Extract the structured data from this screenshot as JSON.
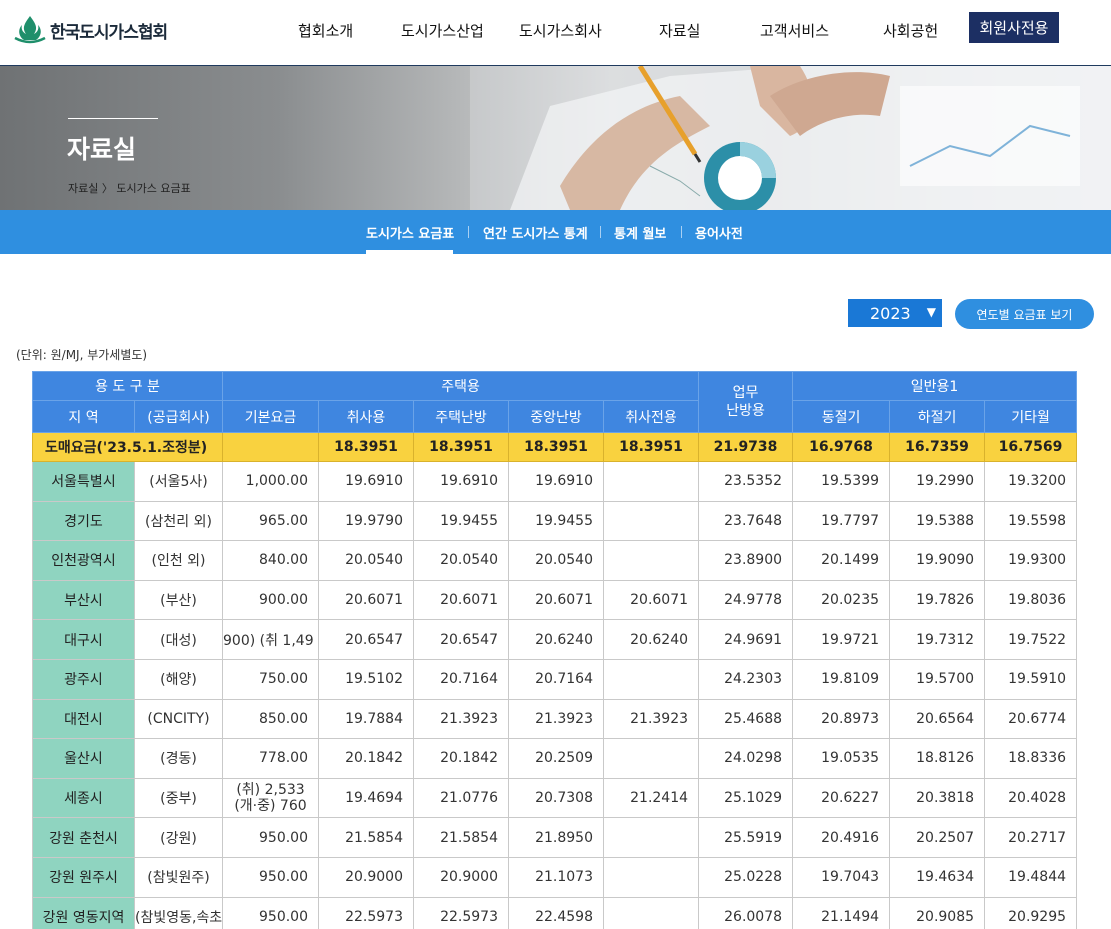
{
  "header": {
    "logo_text": "한국도시가스협회",
    "nav": [
      "협회소개",
      "도시가스산업",
      "도시가스회사",
      "자료실",
      "고객서비스",
      "사회공헌"
    ],
    "member_button": "회원사전용"
  },
  "banner": {
    "title": "자료실",
    "breadcrumb_root": "자료실",
    "breadcrumb_sep": "〉",
    "breadcrumb_current": "도시가스 요금표"
  },
  "subnav": {
    "items": [
      "도시가스 요금표",
      "연간 도시가스 통계",
      "통계 월보",
      "용어사전"
    ],
    "active": "도시가스 요금표"
  },
  "controls": {
    "year": "2023",
    "year_button": "연도별 요금표 보기"
  },
  "unit_note": "(단위: 원/MJ, 부가세별도)",
  "table": {
    "group_headers": {
      "usage_type": "용 도 구 분",
      "residential": "주택용",
      "business_heating": "업무\n난방용",
      "general1": "일반용1"
    },
    "sub_headers": [
      "지 역",
      "(공급회사)",
      "기본요금",
      "취사용",
      "주택난방",
      "중앙난방",
      "취사전용",
      "동절기",
      "하절기",
      "기타월"
    ],
    "wholesale": {
      "label": "도매요금('23.5.1.조정분)",
      "values": [
        "",
        "18.3951",
        "18.3951",
        "18.3951",
        "18.3951",
        "21.9738",
        "16.9768",
        "16.7359",
        "16.7569"
      ]
    },
    "rows": [
      {
        "region": "서울특별시",
        "company": "(서울5사)",
        "base": "1,000.00",
        "cooking": "19.6910",
        "home_heating": "19.6910",
        "central_heating": "19.6910",
        "cooking_only": "",
        "business": "23.5352",
        "winter": "19.5399",
        "summer": "19.2990",
        "other": "19.3200"
      },
      {
        "region": "경기도",
        "company": "(삼천리 외)",
        "base": "965.00",
        "cooking": "19.9790",
        "home_heating": "19.9455",
        "central_heating": "19.9455",
        "cooking_only": "",
        "business": "23.7648",
        "winter": "19.7797",
        "summer": "19.5388",
        "other": "19.5598"
      },
      {
        "region": "인천광역시",
        "company": "(인천 외)",
        "base": "840.00",
        "cooking": "20.0540",
        "home_heating": "20.0540",
        "central_heating": "20.0540",
        "cooking_only": "",
        "business": "23.8900",
        "winter": "20.1499",
        "summer": "19.9090",
        "other": "19.9300"
      },
      {
        "region": "부산시",
        "company": "(부산)",
        "base": "900.00",
        "cooking": "20.6071",
        "home_heating": "20.6071",
        "central_heating": "20.6071",
        "cooking_only": "20.6071",
        "business": "24.9778",
        "winter": "20.0235",
        "summer": "19.7826",
        "other": "19.8036"
      },
      {
        "region": "대구시",
        "company": "(대성)",
        "base": "900) (취 1,49",
        "cooking": "20.6547",
        "home_heating": "20.6547",
        "central_heating": "20.6240",
        "cooking_only": "20.6240",
        "business": "24.9691",
        "winter": "19.9721",
        "summer": "19.7312",
        "other": "19.7522"
      },
      {
        "region": "광주시",
        "company": "(해양)",
        "base": "750.00",
        "cooking": "19.5102",
        "home_heating": "20.7164",
        "central_heating": "20.7164",
        "cooking_only": "",
        "business": "24.2303",
        "winter": "19.8109",
        "summer": "19.5700",
        "other": "19.5910"
      },
      {
        "region": "대전시",
        "company": "(CNCITY)",
        "base": "850.00",
        "cooking": "19.7884",
        "home_heating": "21.3923",
        "central_heating": "21.3923",
        "cooking_only": "21.3923",
        "business": "25.4688",
        "winter": "20.8973",
        "summer": "20.6564",
        "other": "20.6774"
      },
      {
        "region": "울산시",
        "company": "(경동)",
        "base": "778.00",
        "cooking": "20.1842",
        "home_heating": "20.1842",
        "central_heating": "20.2509",
        "cooking_only": "",
        "business": "24.0298",
        "winter": "19.0535",
        "summer": "18.8126",
        "other": "18.8336"
      },
      {
        "region": "세종시",
        "company": "(중부)",
        "base": "(취) 2,533",
        "base2": "(개·중) 760",
        "cooking": "19.4694",
        "home_heating": "21.0776",
        "central_heating": "20.7308",
        "cooking_only": "21.2414",
        "business": "25.1029",
        "winter": "20.6227",
        "summer": "20.3818",
        "other": "20.4028"
      },
      {
        "region": "강원 춘천시",
        "company": "(강원)",
        "base": "950.00",
        "cooking": "21.5854",
        "home_heating": "21.5854",
        "central_heating": "21.8950",
        "cooking_only": "",
        "business": "25.5919",
        "winter": "20.4916",
        "summer": "20.2507",
        "other": "20.2717"
      },
      {
        "region": "강원 원주시",
        "company": "(참빛원주)",
        "base": "950.00",
        "cooking": "20.9000",
        "home_heating": "20.9000",
        "central_heating": "21.1073",
        "cooking_only": "",
        "business": "25.0228",
        "winter": "19.7043",
        "summer": "19.4634",
        "other": "19.4844"
      },
      {
        "region": "강원 영동지역",
        "company": "(참빛영동,속초)",
        "base": "950.00",
        "cooking": "22.5973",
        "home_heating": "22.5973",
        "central_heating": "22.4598",
        "cooking_only": "",
        "business": "26.0078",
        "winter": "21.1494",
        "summer": "20.9085",
        "other": "20.9295"
      }
    ]
  }
}
